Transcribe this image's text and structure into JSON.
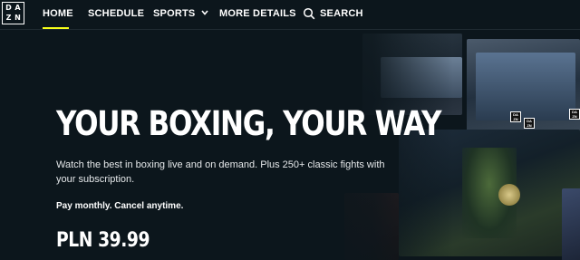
{
  "brand": {
    "logo_letters": [
      "D",
      "A",
      "Z",
      "N"
    ]
  },
  "nav": {
    "items": [
      {
        "label": "HOME",
        "active": true
      },
      {
        "label": "SCHEDULE"
      },
      {
        "label": "SPORTS"
      },
      {
        "label": "MORE DETAILS"
      }
    ],
    "search_label": "SEARCH"
  },
  "hero": {
    "headline": "YOUR BOXING, YOUR WAY",
    "subtitle": "Watch the best in boxing live and on demand. Plus 250+ classic fights with your subscription.",
    "tagline": "Pay monthly. Cancel anytime.",
    "price": "PLN 39.99"
  },
  "colors": {
    "background": "#0c161c",
    "accent": "#f7ff1a",
    "text": "#ffffff"
  },
  "icons": [
    "search-icon",
    "chevron-down-icon"
  ]
}
